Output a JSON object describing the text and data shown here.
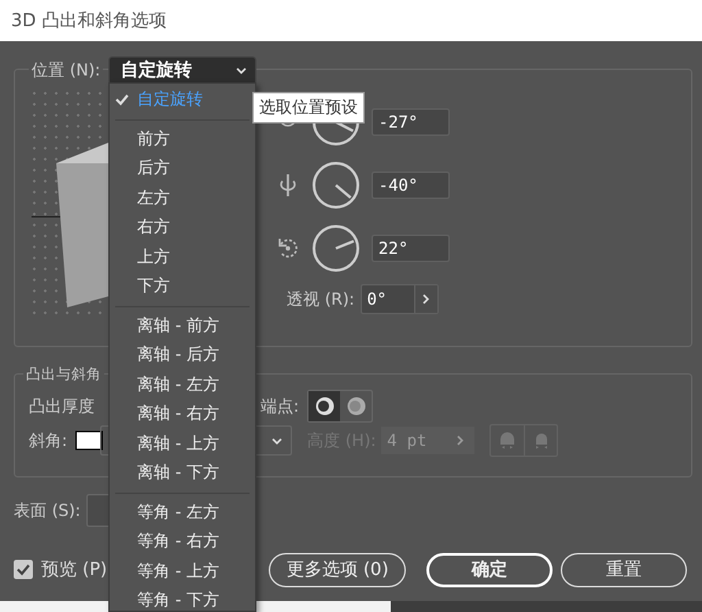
{
  "window": {
    "title": "3D 凸出和斜角选项"
  },
  "position": {
    "label": "位置 (N):",
    "value": "自定旋转"
  },
  "position_menu": {
    "sections": [
      {
        "items": [
          {
            "label": "自定旋转",
            "selected": true
          }
        ]
      },
      {
        "items": [
          {
            "label": "前方",
            "selected": false
          },
          {
            "label": "后方",
            "selected": false
          },
          {
            "label": "左方",
            "selected": false
          },
          {
            "label": "右方",
            "selected": false
          },
          {
            "label": "上方",
            "selected": false
          },
          {
            "label": "下方",
            "selected": false
          }
        ]
      },
      {
        "items": [
          {
            "label": "离轴 - 前方",
            "selected": false
          },
          {
            "label": "离轴 - 后方",
            "selected": false
          },
          {
            "label": "离轴 - 左方",
            "selected": false
          },
          {
            "label": "离轴 - 右方",
            "selected": false
          },
          {
            "label": "离轴 - 上方",
            "selected": false
          },
          {
            "label": "离轴 - 下方",
            "selected": false
          }
        ]
      },
      {
        "items": [
          {
            "label": "等角 - 左方",
            "selected": false
          },
          {
            "label": "等角 - 右方",
            "selected": false
          },
          {
            "label": "等角 - 上方",
            "selected": false
          },
          {
            "label": "等角 - 下方",
            "selected": false
          }
        ]
      }
    ]
  },
  "tooltip": "选取位置预设",
  "rotation": [
    {
      "kind": "x",
      "value": "-27°"
    },
    {
      "kind": "y",
      "value": "-40°"
    },
    {
      "kind": "z",
      "value": "22°"
    }
  ],
  "perspective": {
    "label": "透视 (R):",
    "value": "0°"
  },
  "extrude": {
    "legend": "凸出与斜角",
    "depth_label": "凸出厚度",
    "cap_label": "端点:",
    "caps": [
      {
        "selected": true
      },
      {
        "selected": false
      }
    ],
    "bevel_label": "斜角:",
    "height_label": "高度 (H):",
    "height_value": "4 pt",
    "height_disabled": true
  },
  "surface": {
    "label": "表面 (S):"
  },
  "preview": {
    "label": "预览 (P)",
    "checked": true
  },
  "buttons": [
    {
      "label": "更多选项 (0)",
      "primary": false
    },
    {
      "label": "确定",
      "primary": true
    },
    {
      "label": "重置",
      "primary": false
    }
  ]
}
